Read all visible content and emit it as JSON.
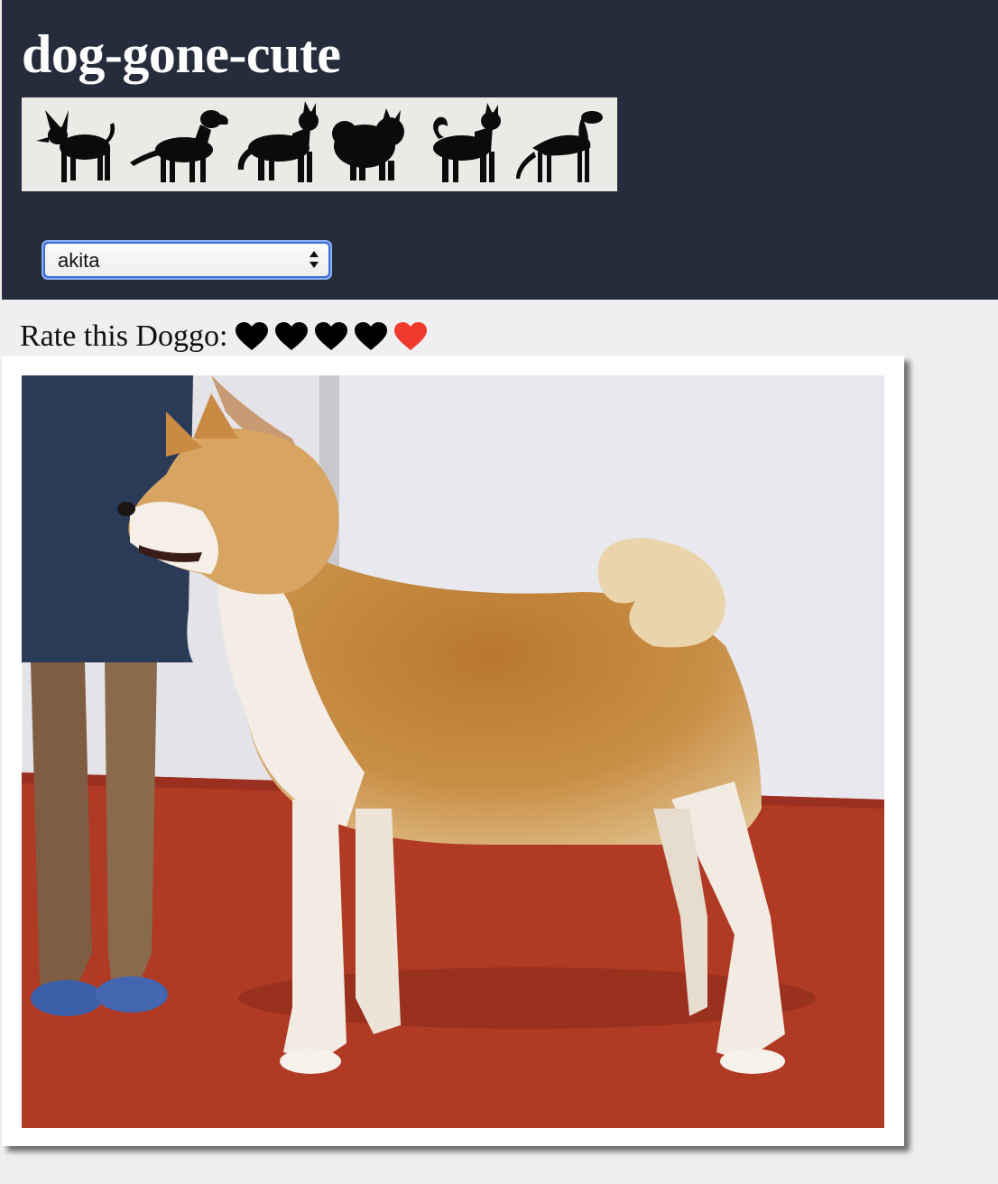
{
  "header": {
    "title": "dog-gone-cute",
    "banner_icon": "dog-silhouettes-banner"
  },
  "breed_select": {
    "selected": "akita",
    "icon": "select-arrows-icon"
  },
  "rating": {
    "label": "Rate this Doggo:",
    "max": 5,
    "hearts": [
      {
        "color": "#000000"
      },
      {
        "color": "#000000"
      },
      {
        "color": "#000000"
      },
      {
        "color": "#000000"
      },
      {
        "color": "#f03a2c"
      }
    ],
    "icon": "heart-icon"
  },
  "photo": {
    "subject": "akita-dog-photo"
  },
  "colors": {
    "header_bg": "#252d3c",
    "page_bg": "#efefef",
    "select_focus": "#3b6fd8",
    "accent_heart": "#f03a2c"
  }
}
